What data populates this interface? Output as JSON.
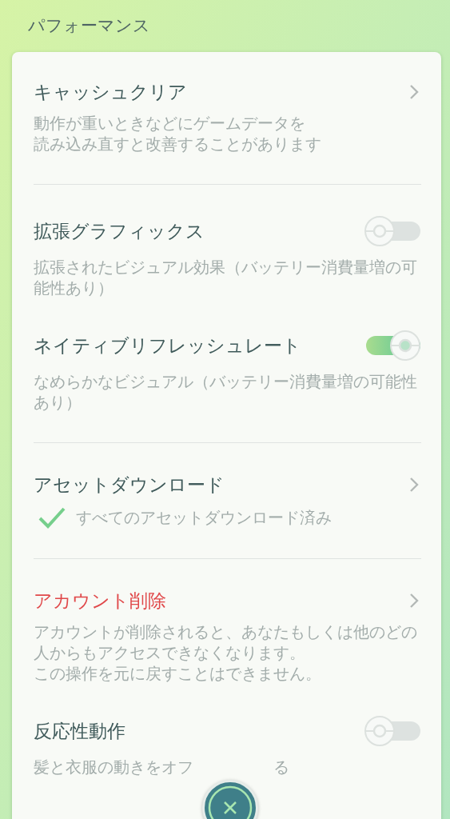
{
  "header": {
    "title": "パフォーマンス"
  },
  "sections": [
    {
      "items": [
        {
          "kind": "link",
          "title": "キャッシュクリア",
          "description": [
            "動作が重いときなどにゲームデータを",
            "読み込み直すと改善することがあります"
          ]
        }
      ]
    },
    {
      "items": [
        {
          "kind": "toggle",
          "title": "拡張グラフィックス",
          "on": false,
          "description": [
            "拡張されたビジュアル効果（バッテリー消費量増の可能性あり）"
          ]
        },
        {
          "kind": "toggle",
          "title": "ネイティブリフレッシュレート",
          "on": true,
          "description": [
            "なめらかなビジュアル（バッテリー消費量増の可能性あり）"
          ]
        }
      ]
    },
    {
      "items": [
        {
          "kind": "link",
          "title": "アセットダウンロード",
          "status": {
            "text": "すべてのアセットダウンロード済み",
            "done": true
          }
        }
      ]
    },
    {
      "items": [
        {
          "kind": "link",
          "title": "アカウント削除",
          "color": "#e0484a",
          "description": [
            "アカウントが削除されると、あなたもしくは他のどの人からもアクセスできなくなります。",
            "この操作を元に戻すことはできません。"
          ]
        },
        {
          "kind": "toggle",
          "title": "反応性動作",
          "on": false,
          "description": [
            "髪と衣服の動きをオフ"
          ],
          "description_tail": "る"
        }
      ]
    }
  ],
  "close_button": {
    "shown": true
  }
}
